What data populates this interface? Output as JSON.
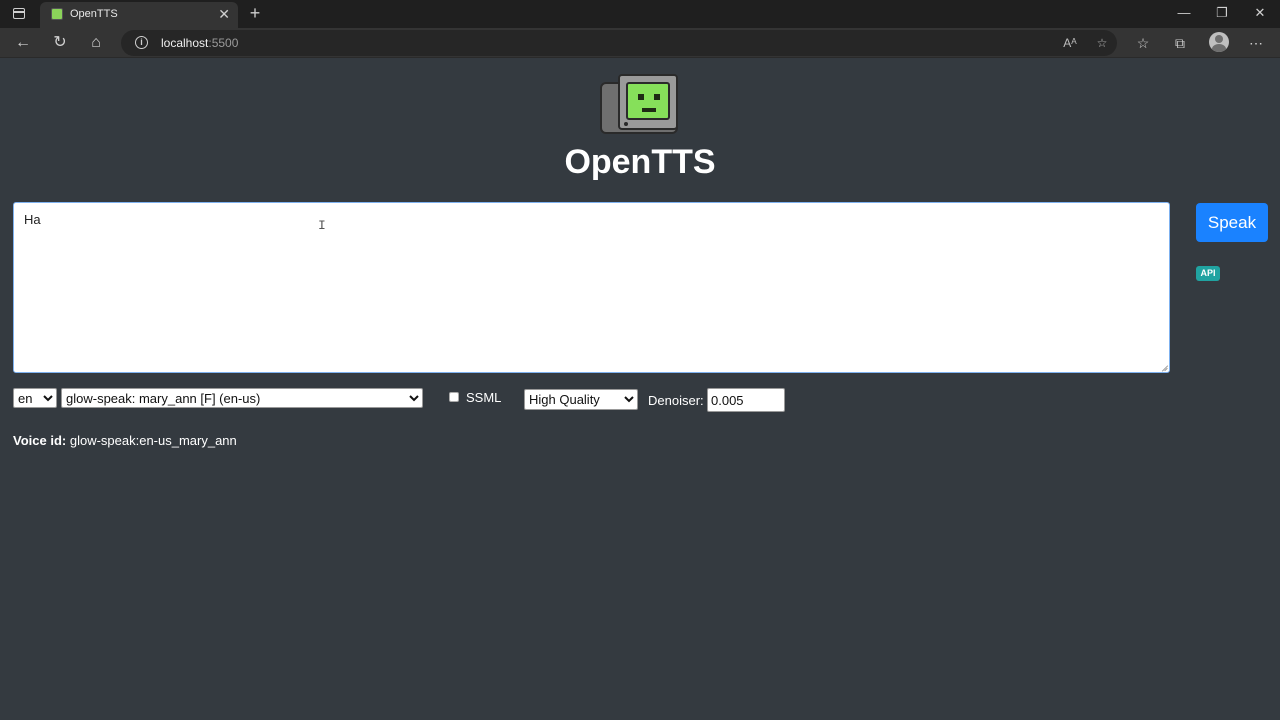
{
  "browser": {
    "tab_title": "OpenTTS",
    "tab_close": "✕",
    "new_tab": "+",
    "url_host": "localhost",
    "url_port": ":5500",
    "window_minimize": "—",
    "window_restore": "❐",
    "window_close": "✕"
  },
  "page": {
    "title": "OpenTTS",
    "text_input": "Ha",
    "speak_label": "Speak",
    "api_badge": "API",
    "language_selected": "en",
    "voice_selected": "glow-speak: mary_ann [F] (en-us)",
    "ssml_label": "SSML",
    "ssml_checked": false,
    "quality_selected": "High Quality",
    "denoiser_label": "Denoiser:",
    "denoiser_value": "0.005",
    "voice_id_label": "Voice id:",
    "voice_id_value": "glow-speak:en-us_mary_ann"
  },
  "colors": {
    "page_bg": "#343a40",
    "speak_button": "#1a82ff",
    "api_badge": "#20a3a1",
    "logo_screen": "#86e05a"
  }
}
